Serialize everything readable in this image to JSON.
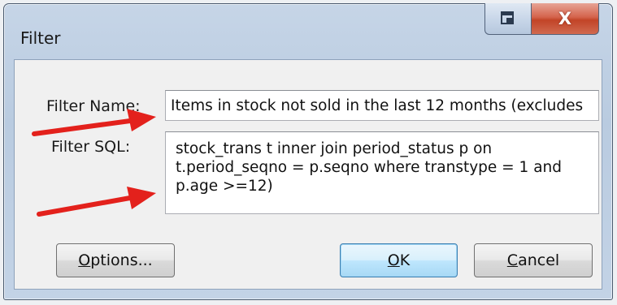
{
  "window": {
    "title": "Filter",
    "controls": {
      "restore_icon": "restore-window-icon",
      "close_glyph": "X"
    }
  },
  "form": {
    "name_label": "Filter Name:",
    "name_value": "Items in stock not sold in the last 12 months (excludes",
    "sql_label": "Filter SQL:",
    "sql_value": "stock_trans t inner join period_status p on t.period_seqno = p.seqno where transtype = 1 and p.age >=12)"
  },
  "buttons": {
    "options": {
      "prefix": "O",
      "rest": "ptions..."
    },
    "ok": {
      "prefix": "O",
      "rest": "K"
    },
    "cancel": {
      "prefix": "C",
      "rest": "ancel"
    }
  },
  "annotations": {
    "arrow_color": "#e3211c"
  },
  "colors": {
    "close_button": "#c24427",
    "default_button_border": "#3c7fb1",
    "window_frame": "#b9cbe0"
  }
}
